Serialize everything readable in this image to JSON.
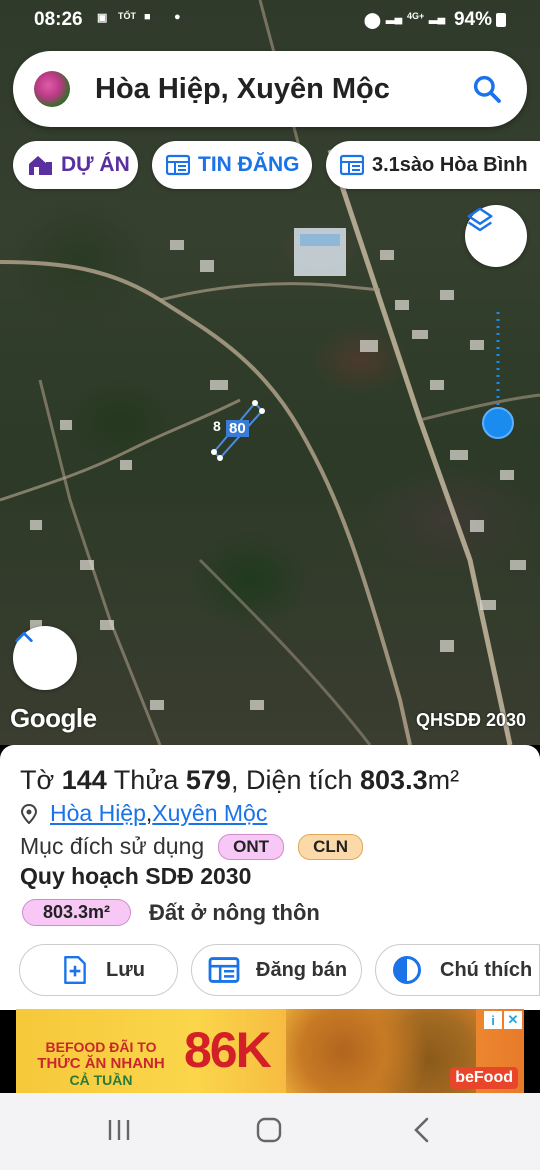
{
  "status_bar": {
    "time": "08:26",
    "carrier_badge": "TỐT",
    "battery": "94%",
    "network": "4G+"
  },
  "search": {
    "title": "Hòa Hiệp, Xuyên Mộc"
  },
  "chips": [
    {
      "label": "DỰ ÁN",
      "color": "#5a2fa0"
    },
    {
      "label": "TIN ĐĂNG",
      "color": "#1a73e8"
    },
    {
      "label": "3.1sào Hòa Bình",
      "color": "#222222"
    }
  ],
  "map": {
    "parcel_label": "80",
    "parcel_label_prefix": "8",
    "attribution": "Google",
    "overlay_label": "QHSDĐ 2030"
  },
  "panel": {
    "sheet_prefix": "Tờ ",
    "sheet_no": "144",
    "plot_prefix": " Thửa ",
    "plot_no": "579",
    "area_prefix": ", Diện tích ",
    "area_value": "803.3",
    "area_unit": "m²",
    "location_commune": "Hòa Hiệp",
    "location_sep": ", ",
    "location_district": "Xuyên Mộc",
    "purpose_label": "Mục đích sử dụng",
    "purpose_tags": [
      {
        "code": "ONT",
        "color": "#f7c8f5",
        "border": "#d18acf"
      },
      {
        "code": "CLN",
        "color": "#fcd9a8",
        "border": "#e0a75a"
      }
    ],
    "planning_title": "Quy hoạch SDĐ 2030",
    "planning_area": "803.3m²",
    "planning_desc": "Đất ở nông thôn",
    "buttons": [
      {
        "label": "Lưu",
        "icon": "add-file-icon"
      },
      {
        "label": "Đăng bán",
        "icon": "newspaper-icon"
      },
      {
        "label": "Chú thích",
        "icon": "half-circle-icon"
      }
    ]
  },
  "ad": {
    "brand_line1": "BEFOOD ĐÃI TO",
    "brand_line2": "THỨC ĂN NHANH",
    "brand_line3": "CẢ TUẦN",
    "price": "86K",
    "logo": "beFood",
    "info_icon": "i",
    "close_icon": "✕"
  },
  "colors": {
    "accent_blue": "#1a73e8",
    "location_blue": "#1a8cf0",
    "parcel_blue": "#3a7bd5"
  }
}
